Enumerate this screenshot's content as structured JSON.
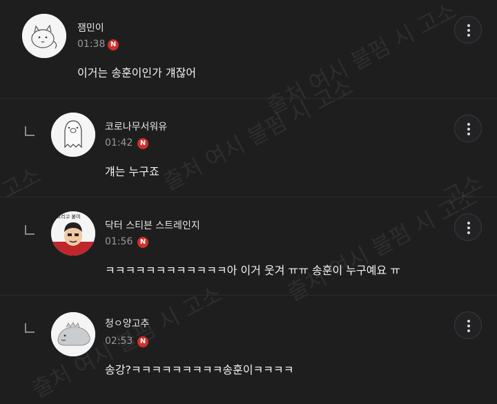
{
  "watermark": {
    "text_full": "출처 여시 불펌 시 고소",
    "text_short": "고소"
  },
  "comments": [
    {
      "nickname": "잼민이",
      "time": "01:38",
      "badge": "N",
      "text": "이거는 송훈이인가 걔잖어",
      "is_reply": false,
      "avatar_icon": "cat-doodle-avatar"
    },
    {
      "nickname": "코로나무서워유",
      "time": "01:42",
      "badge": "N",
      "text": "걔는 누구죠",
      "is_reply": true,
      "avatar_icon": "ghost-pig-avatar"
    },
    {
      "nickname": "닥터 스티븐 스트레인지",
      "time": "01:56",
      "badge": "N",
      "text": "ㅋㅋㅋㅋㅋㅋㅋㅋㅋㅋㅋㅋ아 이거 웃겨 ㅠㅠ 송훈이 누구예요 ㅠ",
      "is_reply": true,
      "avatar_icon": "doctor-strange-cartoon-avatar",
      "avatar_caption": "오리고 붙여"
    },
    {
      "nickname": "청ㅇ양고추",
      "time": "02:53",
      "badge": "N",
      "text": "송강?ㅋㅋㅋㅋㅋㅋㅋㅋㅋ송훈이ㅋㅋㅋㅋ",
      "is_reply": true,
      "avatar_icon": "grey-dinosaur-avatar"
    }
  ],
  "colors": {
    "background": "#1e1e1f",
    "badge": "#d0302b",
    "time": "#9a9a9a"
  }
}
